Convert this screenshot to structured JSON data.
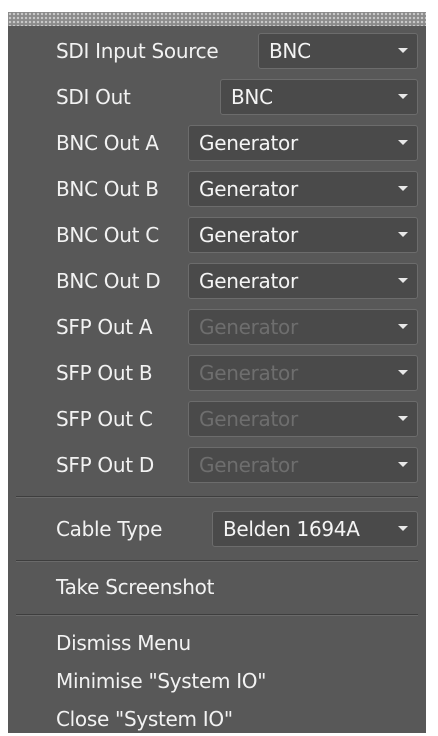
{
  "rows": [
    {
      "label": "SDI Input Source",
      "value": "BNC",
      "disabled": false
    },
    {
      "label": "SDI Out",
      "value": "BNC",
      "disabled": false
    },
    {
      "label": "BNC Out A",
      "value": "Generator",
      "disabled": false
    },
    {
      "label": "BNC Out B",
      "value": "Generator",
      "disabled": false
    },
    {
      "label": "BNC Out C",
      "value": "Generator",
      "disabled": false
    },
    {
      "label": "BNC Out D",
      "value": "Generator",
      "disabled": false
    },
    {
      "label": "SFP Out A",
      "value": "Generator",
      "disabled": true
    },
    {
      "label": "SFP Out B",
      "value": "Generator",
      "disabled": true
    },
    {
      "label": "SFP Out C",
      "value": "Generator",
      "disabled": true
    },
    {
      "label": "SFP Out D",
      "value": "Generator",
      "disabled": true
    }
  ],
  "cable": {
    "label": "Cable Type",
    "value": "Belden 1694A"
  },
  "actions": {
    "take_screenshot": "Take Screenshot",
    "dismiss_menu": "Dismiss Menu",
    "minimise": "Minimise \"System IO\"",
    "close": "Close \"System IO\""
  },
  "icons": {
    "dropdown_arrow": "chevron-down-icon",
    "grip": "drag-handle"
  },
  "colors": {
    "menu_bg": "#585858",
    "text": "#f2f2f2",
    "disabled_text": "#6e6e6e",
    "dropdown_bg": "#4a4a4a"
  }
}
